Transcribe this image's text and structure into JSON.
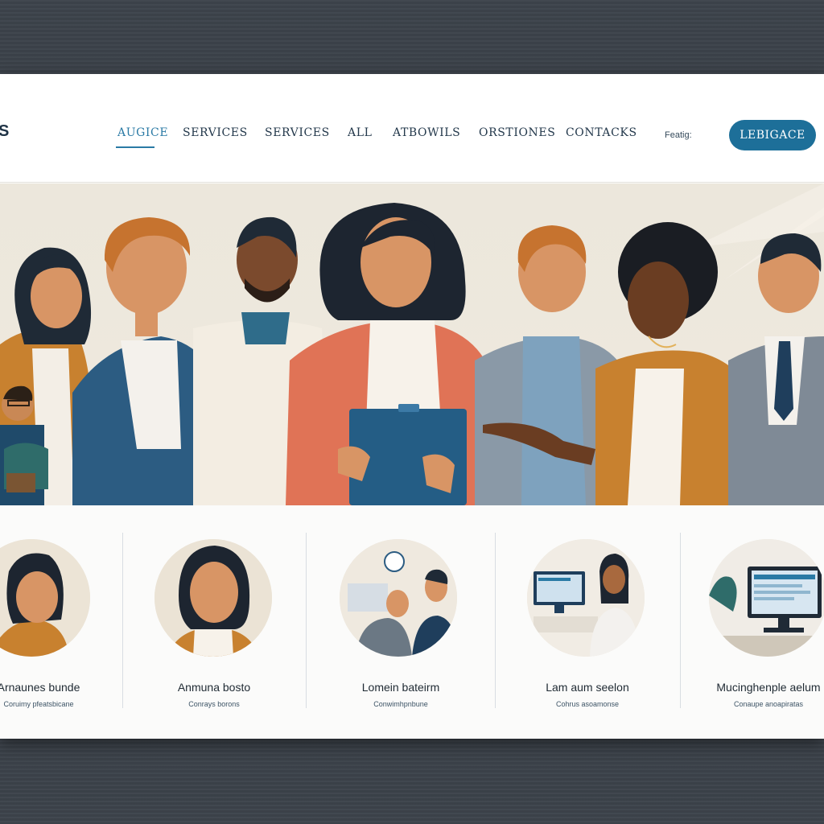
{
  "header": {
    "logo_text": "S",
    "nav": [
      {
        "label": "AUGICE",
        "active": true
      },
      {
        "label": "SERVICES",
        "active": false
      },
      {
        "label": "SERVICES",
        "active": false
      },
      {
        "label": "ALL",
        "active": false
      },
      {
        "label": "ATBOWILS",
        "active": false
      },
      {
        "label": "ORSTIONES",
        "active": false
      },
      {
        "label": "CONTACKS",
        "active": false
      }
    ],
    "feature_text": "Featig:",
    "cta_label": "LEBIGACE"
  },
  "colors": {
    "accent": "#1d6f99",
    "nav_text": "#23384b",
    "hero_bg": "#ece7dc",
    "page_bg": "#3a4149"
  },
  "cards": [
    {
      "title": "Arnaunes bunde",
      "subtitle": "Coruimy pfeatsbicane",
      "image": "woman-portrait"
    },
    {
      "title": "Anmuna bosto",
      "subtitle": "Conrays borons",
      "image": "smiling-woman-portrait"
    },
    {
      "title": "Lomein bateirm",
      "subtitle": "Conwimhpnbune",
      "image": "office-meeting"
    },
    {
      "title": "Lam aum seelon",
      "subtitle": "Cohrus asoamonse",
      "image": "woman-at-computer"
    },
    {
      "title": "Mucinghenple aelum",
      "subtitle": "Conaupe anoapiratas",
      "image": "computer-monitor"
    }
  ]
}
